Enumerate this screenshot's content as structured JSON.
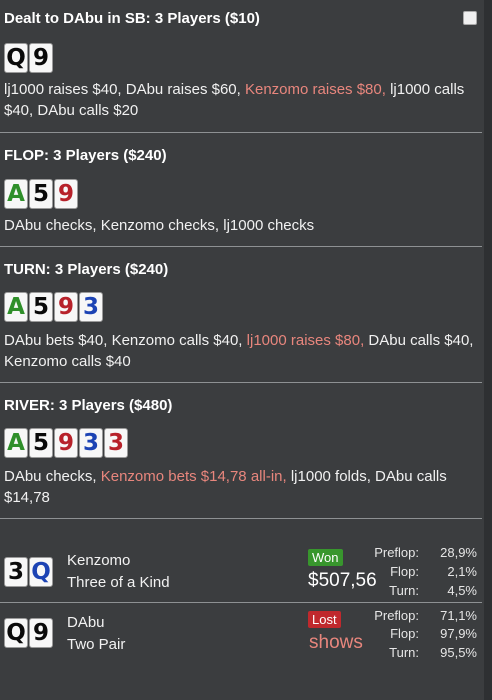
{
  "preflop": {
    "header": "Dealt to DAbu in SB: 3 Players ($10)",
    "cards": [
      {
        "rank": "Q",
        "suit_color": "black"
      },
      {
        "rank": "9",
        "suit_color": "black"
      }
    ],
    "actions": [
      {
        "text": "lj1000 raises $40, DAbu raises $60, ",
        "aggressive": false
      },
      {
        "text": "Kenzomo raises $80,",
        "aggressive": true
      },
      {
        "text": " lj1000 calls $40, DAbu calls $20",
        "aggressive": false
      }
    ]
  },
  "flop": {
    "header": "FLOP: 3 Players ($240)",
    "cards": [
      {
        "rank": "A",
        "suit_color": "green"
      },
      {
        "rank": "5",
        "suit_color": "black"
      },
      {
        "rank": "9",
        "suit_color": "red"
      }
    ],
    "actions": [
      {
        "text": "DAbu checks, Kenzomo checks, lj1000 checks",
        "aggressive": false
      }
    ]
  },
  "turn": {
    "header": "TURN: 3 Players ($240)",
    "cards": [
      {
        "rank": "A",
        "suit_color": "green"
      },
      {
        "rank": "5",
        "suit_color": "black"
      },
      {
        "rank": "9",
        "suit_color": "red"
      },
      {
        "rank": "3",
        "suit_color": "blue"
      }
    ],
    "actions": [
      {
        "text": "DAbu bets $40, Kenzomo calls $40, ",
        "aggressive": false
      },
      {
        "text": "lj1000 raises $80,",
        "aggressive": true
      },
      {
        "text": " DAbu calls $40, Kenzomo calls $40",
        "aggressive": false
      }
    ]
  },
  "river": {
    "header": "RIVER: 3 Players ($480)",
    "cards": [
      {
        "rank": "A",
        "suit_color": "green"
      },
      {
        "rank": "5",
        "suit_color": "black"
      },
      {
        "rank": "9",
        "suit_color": "red"
      },
      {
        "rank": "3",
        "suit_color": "blue"
      },
      {
        "rank": "3",
        "suit_color": "red"
      }
    ],
    "actions": [
      {
        "text": "DAbu checks, ",
        "aggressive": false
      },
      {
        "text": "Kenzomo bets $14,78 all-in,",
        "aggressive": true
      },
      {
        "text": " lj1000 folds, DAbu calls $14,78",
        "aggressive": false
      }
    ]
  },
  "showdown": [
    {
      "cards": [
        {
          "rank": "3",
          "suit_color": "black"
        },
        {
          "rank": "Q",
          "suit_color": "blue"
        }
      ],
      "name": "Kenzomo",
      "hand": "Three of a Kind",
      "result_badge": "Won",
      "result_value": "$507,56",
      "equity": [
        {
          "label": "Preflop:",
          "value": "28,9%"
        },
        {
          "label": "Flop:",
          "value": "2,1%"
        },
        {
          "label": "Turn:",
          "value": "4,5%"
        }
      ]
    },
    {
      "cards": [
        {
          "rank": "Q",
          "suit_color": "black"
        },
        {
          "rank": "9",
          "suit_color": "black"
        }
      ],
      "name": "DAbu",
      "hand": "Two Pair",
      "result_badge": "Lost",
      "result_value": "shows",
      "equity": [
        {
          "label": "Preflop:",
          "value": "71,1%"
        },
        {
          "label": "Flop:",
          "value": "97,9%"
        },
        {
          "label": "Turn:",
          "value": "95,5%"
        }
      ]
    }
  ],
  "colors": {
    "background": "#3b3d3f",
    "aggressive_action": "#e8867d",
    "won_badge": "#38962d",
    "lost_badge": "#c0292d"
  }
}
